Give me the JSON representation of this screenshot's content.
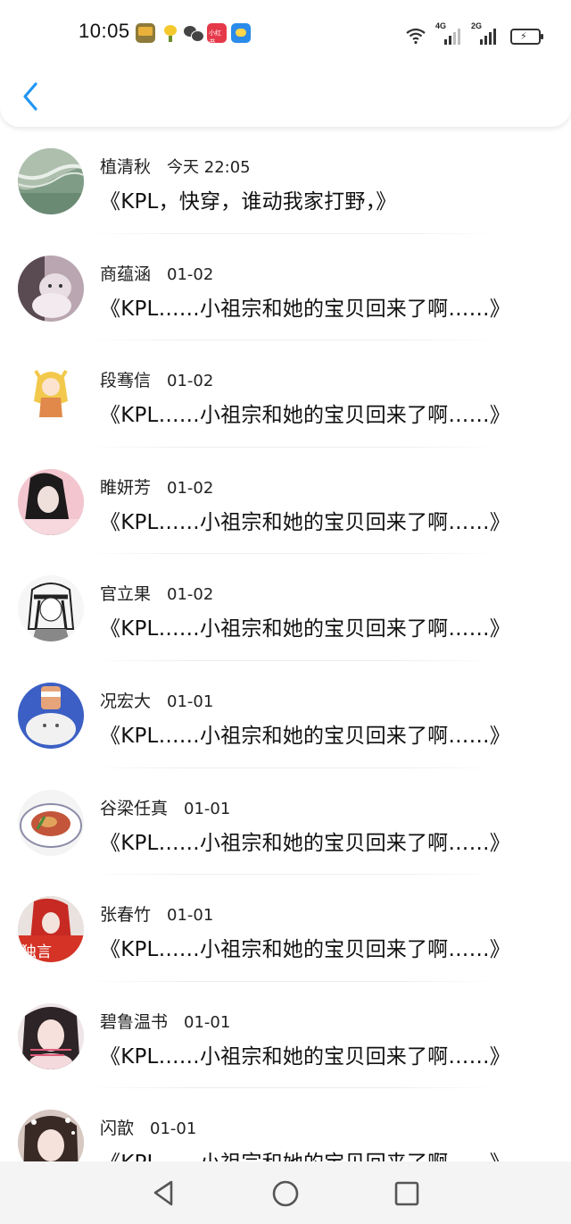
{
  "status_bar": {
    "time": "10:05",
    "notification_icons": [
      "bus-app-icon",
      "bird-app-icon",
      "wechat-icon",
      "xiaohongshu-icon",
      "weather-icon"
    ],
    "notification_badge_text": "小红书",
    "network_1": "4G",
    "network_2": "2G",
    "system_icons": [
      "wifi-icon",
      "signal-icon",
      "battery-charging-icon"
    ]
  },
  "header": {
    "back_icon": "chevron-left-icon",
    "accent_color": "#2196f3"
  },
  "conversations": [
    {
      "name": "植清秋",
      "time": "今天 22:05",
      "preview": "《KPL，快穿，谁动我家打野，》",
      "avatar": "ocean-wave-photo"
    },
    {
      "name": "商蕴涵",
      "time": "01-02",
      "preview": "《KPL……小祖宗和她的宝贝回来了啊……》",
      "avatar": "cat-photo"
    },
    {
      "name": "段骞信",
      "time": "01-02",
      "preview": "《KPL……小祖宗和她的宝贝回来了啊……》",
      "avatar": "anime-girl-blonde"
    },
    {
      "name": "睢妍芳",
      "time": "01-02",
      "preview": "《KPL……小祖宗和她的宝贝回来了啊……》",
      "avatar": "girl-pink-photo"
    },
    {
      "name": "官立果",
      "time": "01-02",
      "preview": "《KPL……小祖宗和她的宝贝回来了啊……》",
      "avatar": "anime-sketch"
    },
    {
      "name": "况宏大",
      "time": "01-01",
      "preview": "《KPL……小祖宗和她的宝贝回来了啊……》",
      "avatar": "cat-with-cup"
    },
    {
      "name": "谷梁任真",
      "time": "01-01",
      "preview": "《KPL……小祖宗和她的宝贝回来了啊……》",
      "avatar": "food-plate"
    },
    {
      "name": "张春竹",
      "time": "01-01",
      "preview": "《KPL……小祖宗和她的宝贝回来了啊……》",
      "avatar": "red-text-girl",
      "avatar_text": "独言"
    },
    {
      "name": "碧鲁温书",
      "time": "01-01",
      "preview": "《KPL……小祖宗和她的宝贝回来了啊……》",
      "avatar": "girl-portrait"
    },
    {
      "name": "闪歆",
      "time": "01-01",
      "preview": "《KPL……小祖宗和她的宝贝回来了啊……》",
      "avatar": "girl-selfie"
    }
  ],
  "nav_bar": {
    "buttons": [
      "back-triangle-icon",
      "home-circle-icon",
      "recent-square-icon"
    ]
  }
}
